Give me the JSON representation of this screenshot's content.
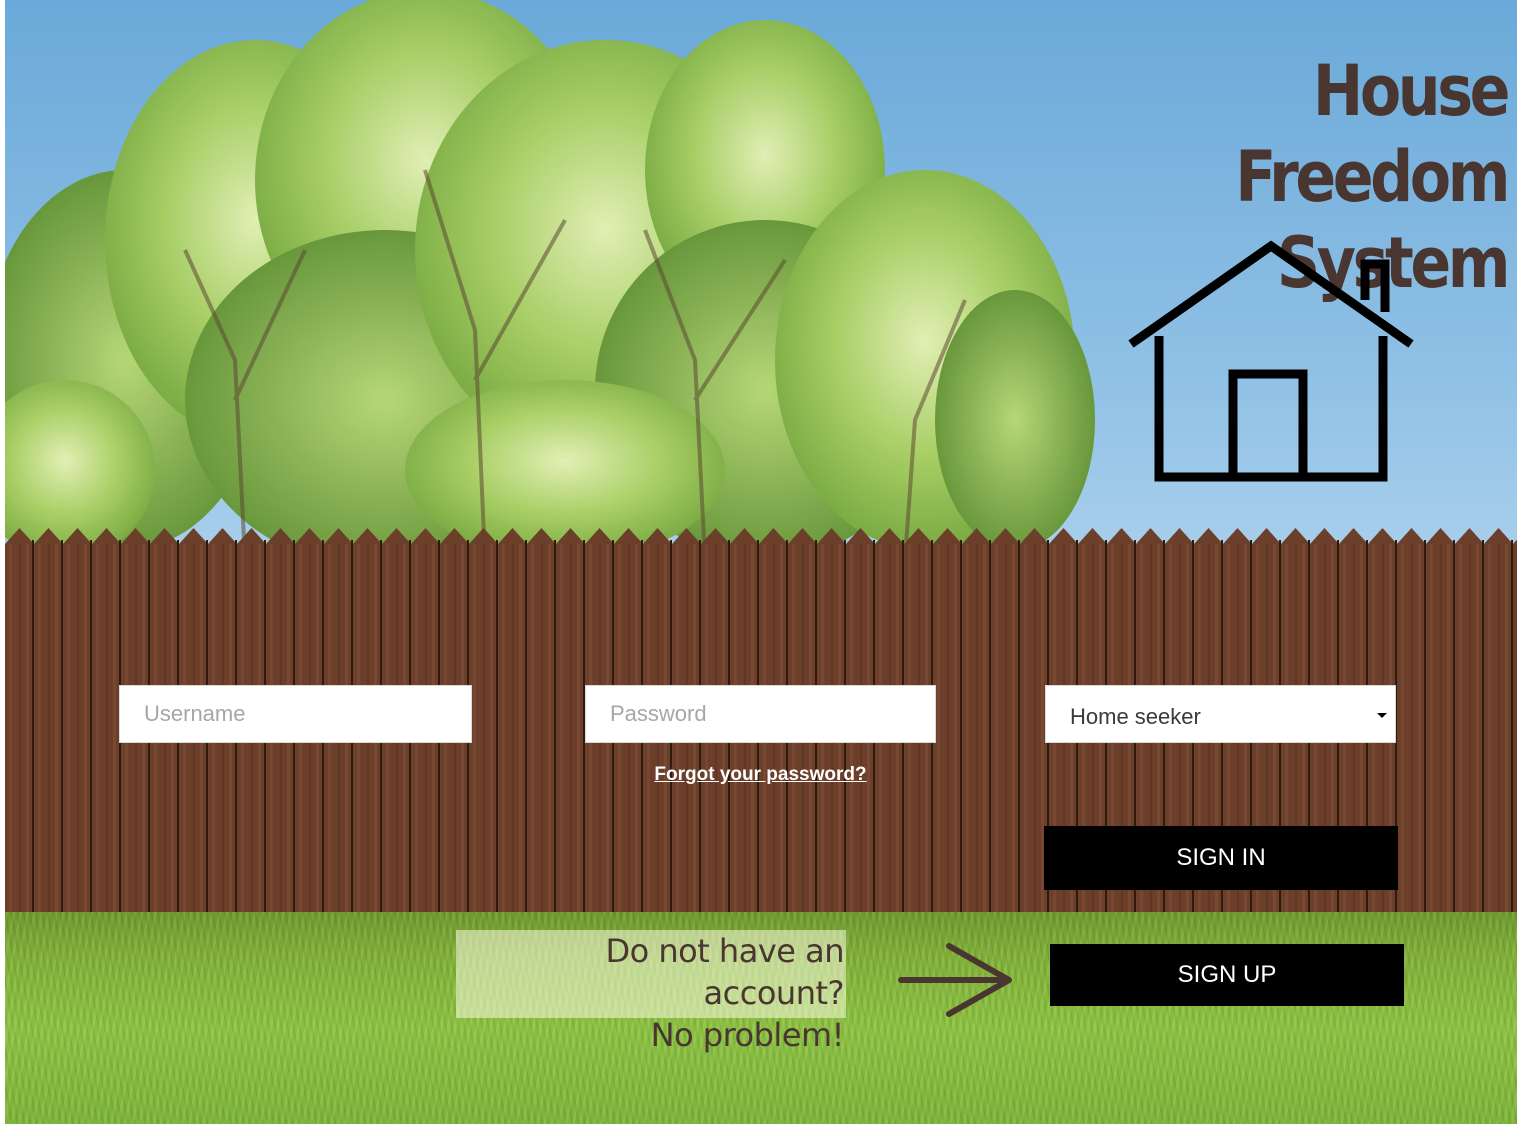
{
  "app": {
    "title_line1": "House Freedom",
    "title_line2": "System"
  },
  "login": {
    "username_placeholder": "Username",
    "password_placeholder": "Password",
    "role_selected": "Home seeker",
    "forgot_link": "Forgot your password?",
    "signin_label": "SIGN IN"
  },
  "signup": {
    "prompt_line1": "Do not have an account?",
    "prompt_line2": "No problem!",
    "signup_label": "SIGN UP"
  },
  "icons": {
    "logo": "house-outline-icon",
    "pointer": "arrow-right-icon",
    "dropdown": "caret-down-icon"
  },
  "colors": {
    "title": "#4a3630",
    "button_bg": "#000000",
    "button_text": "#ffffff",
    "sky": "#92c2e6",
    "fence": "#6a3e2b",
    "grass": "#8cc43f"
  }
}
